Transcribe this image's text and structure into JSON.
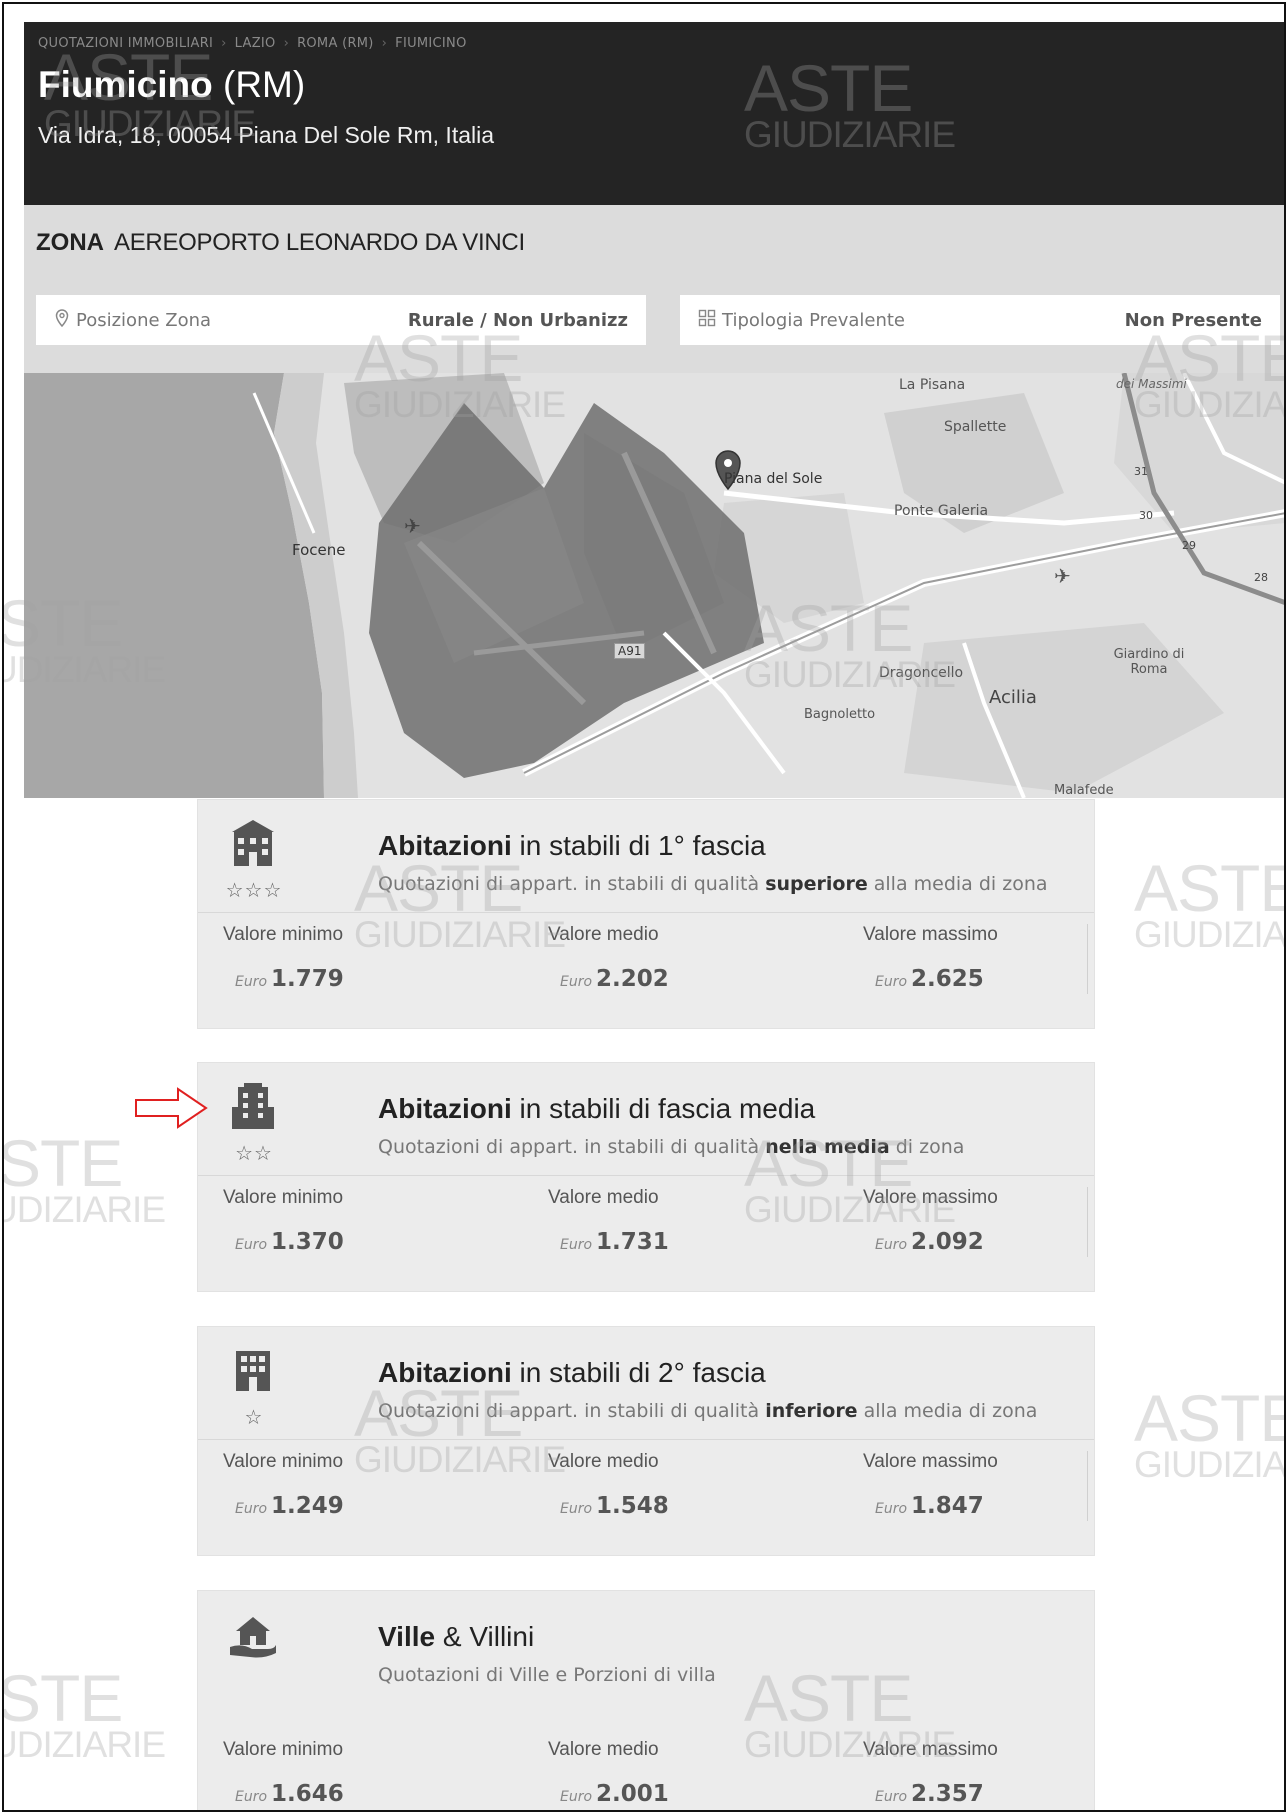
{
  "breadcrumb": [
    "QUOTAZIONI IMMOBILIARI",
    "LAZIO",
    "ROMA (RM)",
    "FIUMICINO"
  ],
  "header": {
    "city": "Fiumicino",
    "province": "(RM)",
    "address": "Via Idra, 18, 00054 Piana Del Sole Rm, Italia"
  },
  "zona": {
    "label": "ZONA",
    "name": "AEREOPORTO LEONARDO DA VINCI",
    "posizione_label": "Posizione Zona",
    "posizione_value": "Rurale / Non Urbanizz",
    "tipologia_label": "Tipologia Prevalente",
    "tipologia_value": "Non Presente"
  },
  "map": {
    "places": [
      "La Pisana",
      "Spallette",
      "Piana del Sole",
      "Ponte Galeria",
      "Focene",
      "Dragoncello",
      "Acilia",
      "Bagnoletto",
      "Giardino di Roma",
      "Malafede",
      "A91",
      "dei Massimi"
    ],
    "road_numbers": [
      "31",
      "30",
      "29",
      "28"
    ]
  },
  "cards": [
    {
      "icon": "building-luxury-icon",
      "stars": "☆☆☆",
      "title_bold": "Abitazioni",
      "title_rest": " in stabili di 1° fascia",
      "sub_pre": "Quotazioni di appart. in stabili di qualità ",
      "sub_bold": "superiore",
      "sub_post": " alla media di zona",
      "min_label": "Valore minimo",
      "min": "1.779",
      "med_label": "Valore medio",
      "med": "2.202",
      "max_label": "Valore massimo",
      "max": "2.625",
      "currency": "Euro"
    },
    {
      "icon": "building-medium-icon",
      "stars": "☆☆",
      "title_bold": "Abitazioni",
      "title_rest": " in stabili di fascia media",
      "sub_pre": "Quotazioni di appart. in stabili di qualità ",
      "sub_bold": "nella media",
      "sub_post": " di zona",
      "min_label": "Valore minimo",
      "min": "1.370",
      "med_label": "Valore medio",
      "med": "1.731",
      "max_label": "Valore massimo",
      "max": "2.092",
      "currency": "Euro"
    },
    {
      "icon": "building-low-icon",
      "stars": "☆",
      "title_bold": "Abitazioni",
      "title_rest": " in stabili di 2° fascia",
      "sub_pre": "Quotazioni di appart. in stabili di qualità ",
      "sub_bold": "inferiore",
      "sub_post": " alla media di zona",
      "min_label": "Valore minimo",
      "min": "1.249",
      "med_label": "Valore medio",
      "med": "1.548",
      "max_label": "Valore massimo",
      "max": "1.847",
      "currency": "Euro"
    },
    {
      "icon": "villa-hand-icon",
      "stars": "",
      "title_bold": "Ville",
      "title_rest": " & Villini",
      "sub_pre": "Quotazioni di Ville e Porzioni di villa",
      "sub_bold": "",
      "sub_post": "",
      "min_label": "Valore minimo",
      "min": "1.646",
      "med_label": "Valore medio",
      "med": "2.001",
      "max_label": "Valore massimo",
      "max": "2.357",
      "currency": "Euro"
    }
  ],
  "watermark": {
    "line1": "ASTE",
    "line2": "GIUDIZIARIE"
  },
  "colors": {
    "header_bg": "#242424",
    "band_bg": "#dcdcdc",
    "card_bg": "#ececec",
    "arrow": "#e02020"
  }
}
